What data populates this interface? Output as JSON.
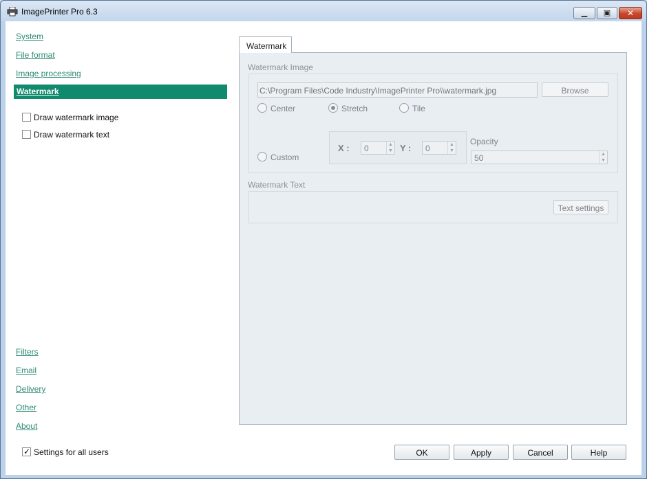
{
  "window": {
    "title": "ImagePrinter Pro 6.3"
  },
  "sidebar": {
    "top_items": [
      {
        "label": "System"
      },
      {
        "label": "File format"
      },
      {
        "label": "Image processing"
      },
      {
        "label": "Watermark"
      }
    ],
    "bottom_items": [
      {
        "label": "Filters"
      },
      {
        "label": "Email"
      },
      {
        "label": "Delivery"
      },
      {
        "label": "Other"
      },
      {
        "label": "About"
      }
    ],
    "options": [
      {
        "label": "Draw watermark image",
        "checked": false
      },
      {
        "label": "Draw watermark text",
        "checked": false
      }
    ],
    "settings_all_users": {
      "label": "Settings for all users",
      "checked": true
    }
  },
  "tab": {
    "label": "Watermark"
  },
  "image_group": {
    "title": "Watermark Image",
    "path": "C:\\Program Files\\Code Industry\\ImagePrinter Pro\\\\watermark.jpg",
    "browse_label": "Browse",
    "positions": [
      {
        "label": "Center",
        "selected": false
      },
      {
        "label": "Stretch",
        "selected": true
      },
      {
        "label": "Tile",
        "selected": false
      },
      {
        "label": "Custom",
        "selected": false
      }
    ],
    "x_label": "X :",
    "x_value": "0",
    "y_label": "Y :",
    "y_value": "0",
    "opacity_label": "Opacity",
    "opacity_value": "50"
  },
  "text_group": {
    "title": "Watermark Text",
    "settings_label": "Text settings"
  },
  "buttons": {
    "ok": "OK",
    "apply": "Apply",
    "cancel": "Cancel",
    "help": "Help"
  },
  "colors": {
    "accent": "#0f8a6c",
    "link": "#2e8a73"
  }
}
